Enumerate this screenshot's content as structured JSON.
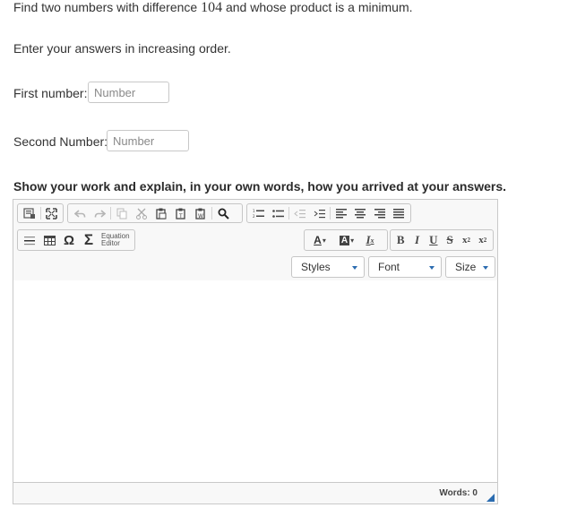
{
  "question": {
    "prefix": "Find two numbers with difference ",
    "number": "104",
    "suffix": " and whose product is a minimum."
  },
  "instruction": "Enter your answers in increasing order.",
  "first": {
    "label": "First number:",
    "placeholder": "Number"
  },
  "second": {
    "label": "Second Number:",
    "placeholder": "Number"
  },
  "work_label": "Show your work and explain, in your own words, how you arrived at your answers.",
  "editor": {
    "equation_line1": "Equation",
    "equation_line2": "Editor",
    "styles_label": "Styles",
    "font_label": "Font",
    "size_label": "Size",
    "words_label": "Words: 0",
    "accent_color": "#2b6cb0"
  }
}
